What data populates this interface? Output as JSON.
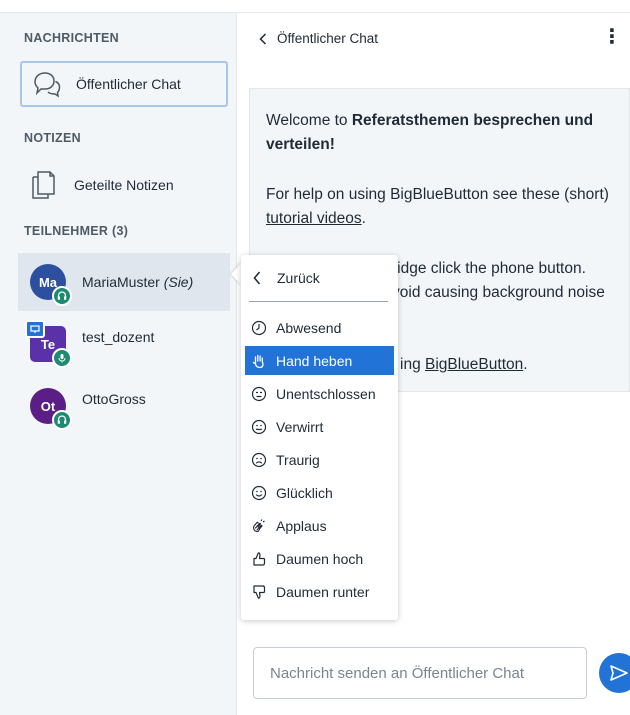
{
  "sidebar": {
    "messages_title": "NACHRICHTEN",
    "public_chat_label": "Öffentlicher Chat",
    "notes_title": "NOTIZEN",
    "shared_notes_label": "Geteilte Notizen",
    "participants_title": "TEILNEHMER (3)",
    "users": [
      {
        "initials": "Ma",
        "name": "MariaMuster",
        "suffix": "(Sie)",
        "color": "#2d4fa0"
      },
      {
        "initials": "Te",
        "name": "test_dozent",
        "suffix": "",
        "color": "#5a31a8"
      },
      {
        "initials": "Ot",
        "name": "OttoGross",
        "suffix": "",
        "color": "#5a1e86"
      }
    ]
  },
  "chat": {
    "header_title": "Öffentlicher Chat",
    "welcome_pre": "Welcome to ",
    "welcome_room": "Referatsthemen besprechen und verteilen",
    "welcome_post": "!",
    "help_text": "For help on using BigBlueButton see these (short) ",
    "help_link": "tutorial videos",
    "help_end": ".",
    "audio_line1_visible": "ridge click the phone button.",
    "audio_line2_visible": "void causing background noise",
    "footer_visible": "ing ",
    "footer_link": "BigBlueButton",
    "footer_end": ".",
    "input_placeholder": "Nachricht senden an Öffentlicher Chat"
  },
  "status_menu": {
    "back_label": "Zurück",
    "items": [
      {
        "label": "Abwesend",
        "icon": "clock-icon"
      },
      {
        "label": "Hand heben",
        "icon": "hand-icon"
      },
      {
        "label": "Unentschlossen",
        "icon": "neutral-face-icon"
      },
      {
        "label": "Verwirrt",
        "icon": "confused-face-icon"
      },
      {
        "label": "Traurig",
        "icon": "sad-face-icon"
      },
      {
        "label": "Glücklich",
        "icon": "happy-face-icon"
      },
      {
        "label": "Applaus",
        "icon": "applause-icon"
      },
      {
        "label": "Daumen hoch",
        "icon": "thumbs-up-icon"
      },
      {
        "label": "Daumen runter",
        "icon": "thumbs-down-icon"
      }
    ],
    "selected": "Hand heben"
  },
  "colors": {
    "accent": "#2173d8",
    "audio_badge": "#1e8a72",
    "sidebar_bg": "#f3f6f9"
  }
}
